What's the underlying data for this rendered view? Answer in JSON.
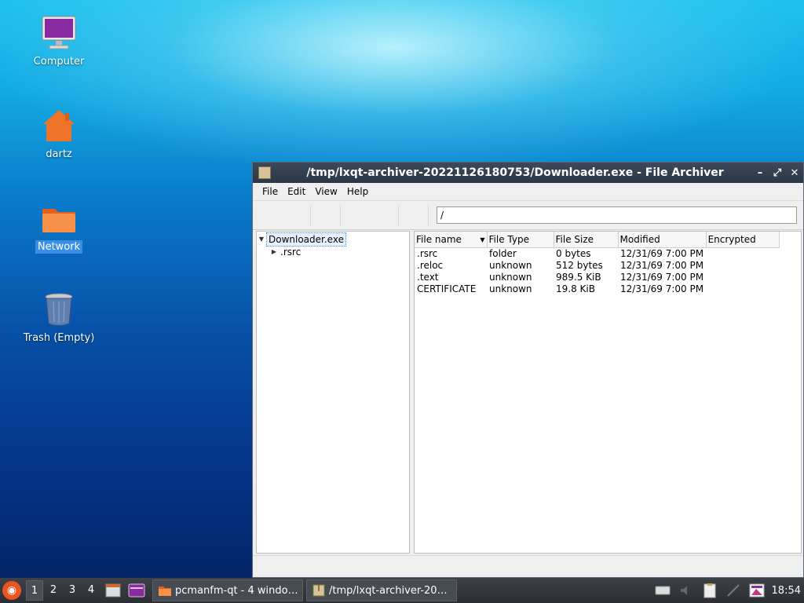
{
  "desktop": {
    "icons": [
      {
        "label": "Computer"
      },
      {
        "label": "dartz"
      },
      {
        "label": "Network"
      },
      {
        "label": "Trash (Empty)"
      }
    ]
  },
  "window": {
    "title": "/tmp/lxqt-archiver-20221126180753/Downloader.exe - File Archiver",
    "controls": {
      "minimize": "–",
      "maximize": "⤢",
      "close": "✕"
    },
    "menu": [
      "File",
      "Edit",
      "View",
      "Help"
    ],
    "path_value": "/",
    "tree": {
      "root": "Downloader.exe",
      "children": [
        ".rsrc"
      ]
    },
    "columns": [
      "File name",
      "File Type",
      "File Size",
      "Modified",
      "Encrypted"
    ],
    "rows": [
      {
        "name": ".rsrc",
        "type": "folder",
        "size": "0 bytes",
        "modified": "12/31/69 7:00 PM",
        "encrypted": ""
      },
      {
        "name": ".reloc",
        "type": "unknown",
        "size": "512 bytes",
        "modified": "12/31/69 7:00 PM",
        "encrypted": ""
      },
      {
        "name": ".text",
        "type": "unknown",
        "size": "989.5 KiB",
        "modified": "12/31/69 7:00 PM",
        "encrypted": ""
      },
      {
        "name": "CERTIFICATE",
        "type": "unknown",
        "size": "19.8 KiB",
        "modified": "12/31/69 7:00 PM",
        "encrypted": ""
      }
    ]
  },
  "taskbar": {
    "workspaces": [
      "1",
      "2",
      "3",
      "4"
    ],
    "tasks": [
      {
        "label": "pcmanfm-qt - 4 windo…"
      },
      {
        "label": "/tmp/lxqt-archiver-20…"
      }
    ],
    "clock": "18:54"
  }
}
